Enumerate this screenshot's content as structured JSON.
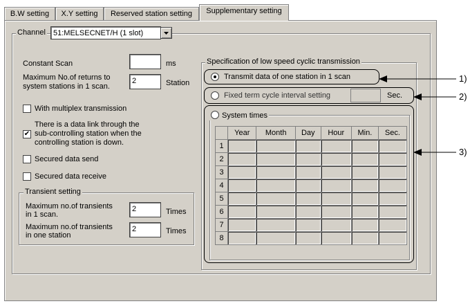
{
  "tabs": [
    "B.W setting",
    "X.Y setting",
    "Reserved station setting",
    "Supplementary setting"
  ],
  "channel": {
    "label": "Channel",
    "value": "51:MELSECNET/H (1 slot)"
  },
  "constant_scan": {
    "label": "Constant Scan",
    "value": "",
    "unit": "ms"
  },
  "max_returns": {
    "label_line1": "Maximum No.of returns to",
    "label_line2": "system stations in 1 scan.",
    "value": "2",
    "unit": "Station"
  },
  "checkboxes": {
    "multiplex": {
      "label": "With multiplex transmission",
      "checked": false
    },
    "data_link": {
      "line1": "There is a data link through the",
      "line2": "sub-controlling station when the",
      "line3": "controlling station is down.",
      "checked": true
    },
    "secured_send": {
      "label": "Secured data send",
      "checked": false
    },
    "secured_receive": {
      "label": "Secured data receive",
      "checked": false
    }
  },
  "transient": {
    "title": "Transient setting",
    "per_scan": {
      "line1": "Maximum no.of transients",
      "line2": "in 1 scan.",
      "value": "2",
      "unit": "Times"
    },
    "per_station": {
      "line1": "Maximum no.of transients",
      "line2": "in one station",
      "value": "2",
      "unit": "Times"
    }
  },
  "low_speed": {
    "title": "Specification of low speed cyclic transmission",
    "opt1": "Transmit data of one station in 1 scan",
    "opt2": "Fixed term cycle interval setting",
    "opt2_unit": "Sec.",
    "opt3": "System times",
    "selected": 1,
    "columns": [
      "Year",
      "Month",
      "Day",
      "Hour",
      "Min.",
      "Sec."
    ],
    "rows": [
      "1",
      "2",
      "3",
      "4",
      "5",
      "6",
      "7",
      "8"
    ]
  },
  "callouts": [
    "1)",
    "2)",
    "3)"
  ]
}
